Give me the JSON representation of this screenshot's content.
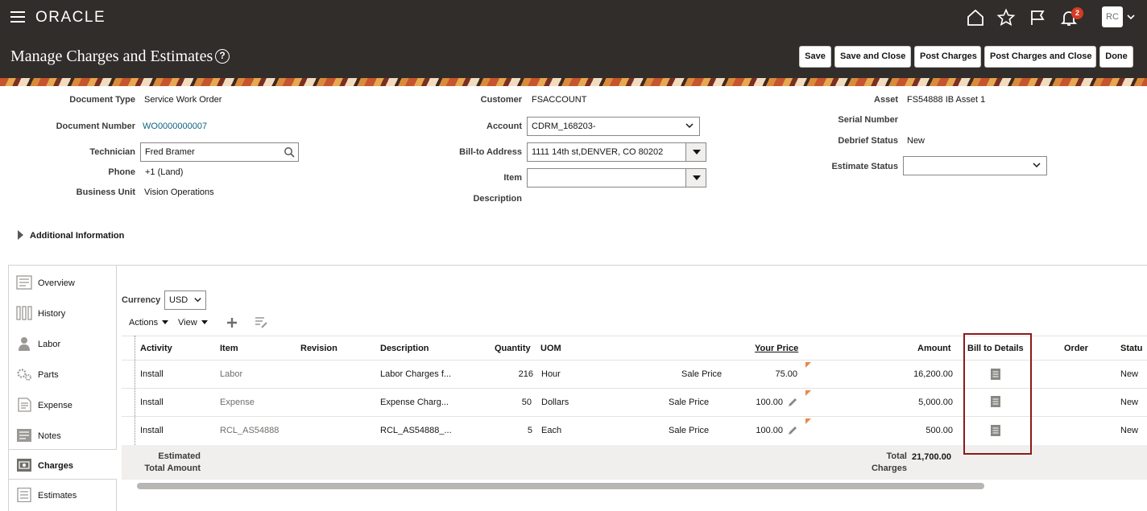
{
  "header": {
    "logo": "ORACLE",
    "notification_count": "2",
    "avatar_initials": "RC"
  },
  "titlebar": {
    "title": "Manage Charges and Estimates",
    "help": "?",
    "buttons": [
      "Save",
      "Save and Close",
      "Post Charges",
      "Post Charges and Close",
      "Done"
    ]
  },
  "form": {
    "document_type_label": "Document Type",
    "document_type": "Service Work Order",
    "document_number_label": "Document Number",
    "document_number": "WO0000000007",
    "technician_label": "Technician",
    "technician": "Fred Bramer",
    "phone_label": "Phone",
    "phone": "+1 (Land)",
    "business_unit_label": "Business Unit",
    "business_unit": "Vision Operations",
    "customer_label": "Customer",
    "customer": "FSACCOUNT",
    "account_label": "Account",
    "account": "CDRM_168203-",
    "bill_to_label": "Bill-to Address",
    "bill_to": "1111 14th st,DENVER, CO 80202",
    "item_label": "Item",
    "item": "",
    "description_label": "Description",
    "asset_label": "Asset",
    "asset": "FS54888 IB Asset 1",
    "serial_label": "Serial Number",
    "debrief_label": "Debrief Status",
    "debrief": "New",
    "estimate_status_label": "Estimate Status",
    "estimate_status": "",
    "additional_info": "Additional Information"
  },
  "tabs": [
    {
      "label": "Overview",
      "icon": "overview-icon"
    },
    {
      "label": "History",
      "icon": "history-icon"
    },
    {
      "label": "Labor",
      "icon": "labor-icon"
    },
    {
      "label": "Parts",
      "icon": "parts-icon"
    },
    {
      "label": "Expense",
      "icon": "expense-icon"
    },
    {
      "label": "Notes",
      "icon": "notes-icon"
    },
    {
      "label": "Charges",
      "icon": "charges-icon",
      "active": true
    },
    {
      "label": "Estimates",
      "icon": "estimates-icon"
    }
  ],
  "charges": {
    "currency_label": "Currency",
    "currency": "USD",
    "actions": "Actions",
    "view": "View",
    "columns": [
      "Activity",
      "Item",
      "Revision",
      "Description",
      "Quantity",
      "UOM",
      "Your Price",
      "Amount",
      "Bill to Details",
      "Order",
      "Statu"
    ],
    "rows": [
      {
        "activity": "Install",
        "item": "Labor",
        "description": "Labor Charges f...",
        "quantity": "216",
        "uom": "Hour",
        "price_type": "Sale Price",
        "price": "75.00",
        "amount": "16,200.00",
        "status": "New"
      },
      {
        "activity": "Install",
        "item": "Expense",
        "description": "Expense Charg...",
        "quantity": "50",
        "uom": "Dollars",
        "price_type": "Sale Price",
        "price": "100.00",
        "amount": "5,000.00",
        "status": "New"
      },
      {
        "activity": "Install",
        "item": "RCL_AS54888",
        "description": "RCL_AS54888_...",
        "quantity": "5",
        "uom": "Each",
        "price_type": "Sale Price",
        "price": "100.00",
        "amount": "500.00",
        "status": "New"
      }
    ],
    "est_total_label_1": "Estimated",
    "est_total_label_2": "Total Amount",
    "total_label_1": "Total",
    "total_label_2": "Charges",
    "total_charges": "21,700.00"
  },
  "colors": {
    "header_bg": "#312d2a",
    "link": "#0e6480",
    "highlight_border": "#8b1a1a"
  }
}
